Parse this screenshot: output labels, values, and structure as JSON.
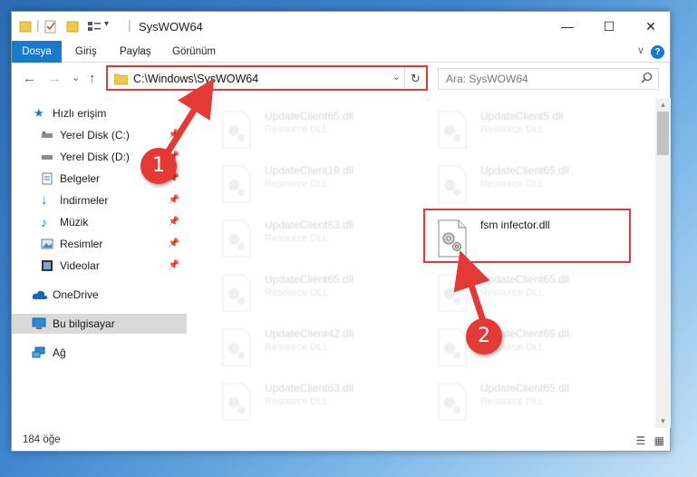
{
  "window": {
    "title": "SysWOW64",
    "controls": {
      "minimize": "—",
      "maximize": "☐",
      "close": "✕"
    }
  },
  "ribbon": {
    "tabs": [
      "Dosya",
      "Giriş",
      "Paylaş",
      "Görünüm"
    ],
    "help": "?"
  },
  "navigation": {
    "back": "←",
    "forward": "→",
    "recent": "⌄",
    "up": "↑",
    "address": "C:\\Windows\\SysWOW64",
    "search_placeholder": "Ara: SysWOW64"
  },
  "sidebar": {
    "items": [
      {
        "label": "Hızlı erişim",
        "icon": "star-icon",
        "pinned": false
      },
      {
        "label": "Yerel Disk (C:)",
        "icon": "drive-icon",
        "pinned": true
      },
      {
        "label": "Yerel Disk (D:)",
        "icon": "drive-icon",
        "pinned": true
      },
      {
        "label": "Belgeler",
        "icon": "documents-icon",
        "pinned": true
      },
      {
        "label": "İndirmeler",
        "icon": "download-icon",
        "pinned": true
      },
      {
        "label": "Müzik",
        "icon": "music-icon",
        "pinned": true
      },
      {
        "label": "Resimler",
        "icon": "pictures-icon",
        "pinned": true
      },
      {
        "label": "Videolar",
        "icon": "videos-icon",
        "pinned": true
      },
      {
        "label": "OneDrive",
        "icon": "cloud-icon",
        "pinned": false
      },
      {
        "label": "Bu bilgisayar",
        "icon": "computer-icon",
        "pinned": false,
        "selected": true
      },
      {
        "label": "Ağ",
        "icon": "network-icon",
        "pinned": false
      }
    ]
  },
  "files": {
    "left_column": [
      {
        "name": "UpdateClient65.dll",
        "type": "Resource DLL"
      },
      {
        "name": "UpdateClient19.dll",
        "type": "Resource DLL"
      },
      {
        "name": "UpdateClient63.dll",
        "type": "Resource DLL"
      },
      {
        "name": "UpdateClient65.dll",
        "type": "Resource DLL"
      },
      {
        "name": "UpdateClient42.dll",
        "type": "Resource DLL"
      },
      {
        "name": "UpdateClient63.dll",
        "type": "Resource DLL"
      }
    ],
    "right_column": [
      {
        "name": "UpdateClient5.dll",
        "type": "Resource DLL"
      },
      {
        "name": "UpdateClient65.dll",
        "type": "Resource DLL"
      },
      {
        "name": "fsm infector.dll",
        "type": "",
        "highlighted": true
      },
      {
        "name": "UpdateClient65.dll",
        "type": "Resource DLL"
      },
      {
        "name": "UpdateClient65.dll",
        "type": "Resource DLL"
      },
      {
        "name": "UpdateClient65.dll",
        "type": "Resource DLL"
      }
    ]
  },
  "status": {
    "item_count": "184 öğe"
  },
  "annotations": {
    "step1": "1",
    "step2": "2",
    "color": "#e53935"
  }
}
